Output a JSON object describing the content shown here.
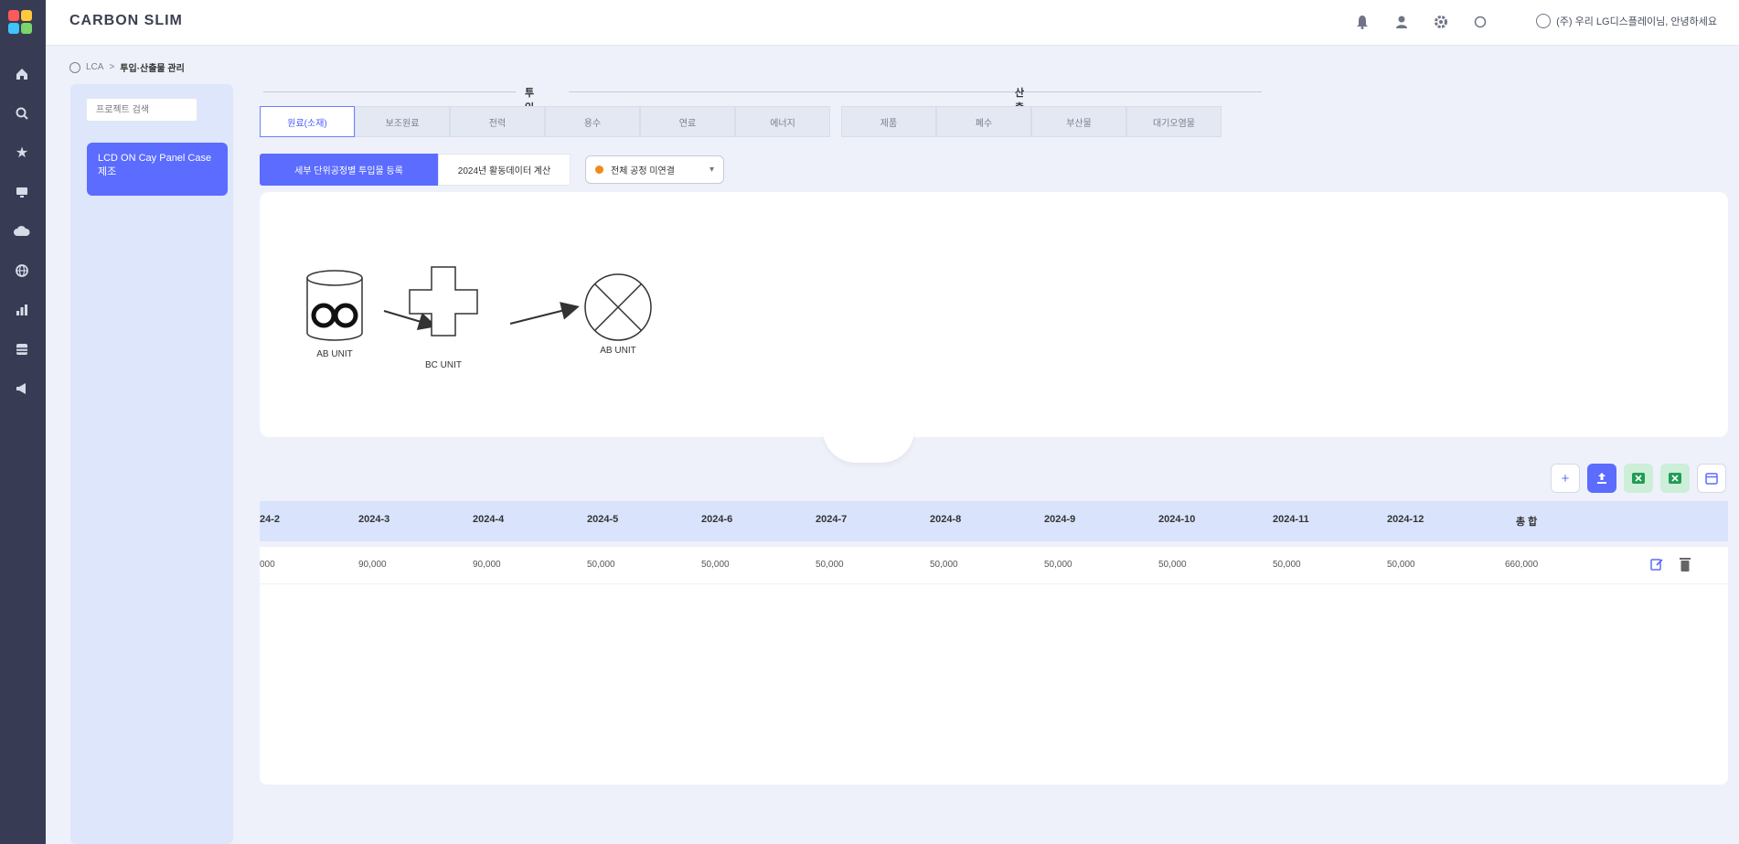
{
  "app": {
    "title": "CARBON SLIM"
  },
  "colors": {
    "sidebar": "#373c54",
    "accent": "#5b6cff",
    "highlight_bg": "#dde6fb",
    "excel": "#1f9d55"
  },
  "header": {
    "icons": [
      "bell-icon",
      "user-icon",
      "gear-icon",
      "power-icon"
    ],
    "user_label": "(주) 우리 LG디스플레이님, 안녕하세요"
  },
  "sidebar": {
    "icons": [
      "home-icon",
      "search-icon",
      "star-icon",
      "monitor-icon",
      "cloud-icon",
      "globe-icon",
      "chart-icon",
      "database-icon",
      "megaphone-icon"
    ]
  },
  "breadcrumb": {
    "parent": "LCA",
    "separator": ">",
    "current": "투입·산출물 관리"
  },
  "left_panel": {
    "search_placeholder": "프로젝트 검색",
    "items": [
      {
        "label": "LCD ON Cay Panel Case 제조"
      }
    ]
  },
  "tab_groups": [
    {
      "label": "투입물",
      "tabs": [
        "원료(소재)",
        "보조원료",
        "전력",
        "용수",
        "연료",
        "에너지"
      ]
    },
    {
      "label": "산출물",
      "tabs": [
        "제품",
        "폐수",
        "부산물",
        "대기오염물"
      ]
    }
  ],
  "actions": {
    "primary_label": "세부 단위공정별 투입물 등록",
    "secondary_label": "2024년 활동데이터 계산",
    "select_value": "전체 공정 미연결"
  },
  "diagram": {
    "nodes": [
      {
        "label": "AB UNIT",
        "shape": "cylinder"
      },
      {
        "label": "BC UNIT",
        "shape": "cross"
      },
      {
        "label": "AB UNIT",
        "shape": "circle-x"
      }
    ]
  },
  "table": {
    "toolbar": [
      "add-icon",
      "upload-icon",
      "excel-icon",
      "excel-download-icon",
      "calendar-icon"
    ],
    "columns": [
      "24-2",
      "2024-3",
      "2024-4",
      "2024-5",
      "2024-6",
      "2024-7",
      "2024-8",
      "2024-9",
      "2024-10",
      "2024-11",
      "2024-12",
      "총 합"
    ],
    "rows": [
      [
        "000",
        "90,000",
        "90,000",
        "50,000",
        "50,000",
        "50,000",
        "50,000",
        "50,000",
        "50,000",
        "50,000",
        "50,000",
        "660,000"
      ]
    ]
  }
}
